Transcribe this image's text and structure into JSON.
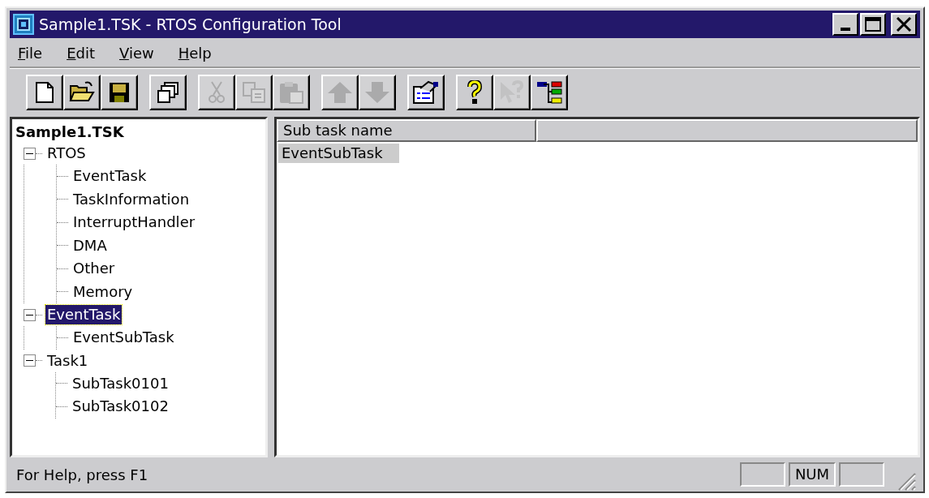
{
  "window": {
    "title": "Sample1.TSK - RTOS Configuration Tool"
  },
  "menu": [
    {
      "label": "File"
    },
    {
      "label": "Edit"
    },
    {
      "label": "View"
    },
    {
      "label": "Help"
    }
  ],
  "toolbar": [
    {
      "buttons": [
        {
          "kind": "new",
          "disabled": false
        },
        {
          "kind": "open",
          "disabled": false
        },
        {
          "kind": "save",
          "disabled": false
        }
      ]
    },
    {
      "buttons": [
        {
          "kind": "windows",
          "disabled": false
        }
      ]
    },
    {
      "buttons": [
        {
          "kind": "cut",
          "disabled": true
        },
        {
          "kind": "copy",
          "disabled": true
        },
        {
          "kind": "paste",
          "disabled": true
        }
      ]
    },
    {
      "buttons": [
        {
          "kind": "up",
          "disabled": true
        },
        {
          "kind": "down",
          "disabled": true
        }
      ]
    },
    {
      "buttons": [
        {
          "kind": "properties",
          "disabled": false
        }
      ]
    },
    {
      "buttons": [
        {
          "kind": "help",
          "disabled": false
        },
        {
          "kind": "context-help",
          "disabled": true
        },
        {
          "kind": "tree",
          "disabled": false
        }
      ]
    }
  ],
  "tree": {
    "root": "Sample1.TSK",
    "items": [
      {
        "label": "RTOS",
        "expanded": true,
        "selected": false,
        "children": [
          {
            "label": "EventTask",
            "selected": false
          },
          {
            "label": "TaskInformation",
            "selected": false
          },
          {
            "label": "InterruptHandler",
            "selected": false
          },
          {
            "label": "DMA",
            "selected": false
          },
          {
            "label": "Other",
            "selected": false
          },
          {
            "label": "Memory",
            "selected": false
          }
        ]
      },
      {
        "label": "EventTask",
        "expanded": true,
        "selected": true,
        "children": [
          {
            "label": "EventSubTask",
            "selected": false
          }
        ]
      },
      {
        "label": "Task1",
        "expanded": true,
        "selected": false,
        "children": [
          {
            "label": "SubTask0101",
            "selected": false
          },
          {
            "label": "SubTask0102",
            "selected": false
          }
        ]
      }
    ]
  },
  "list": {
    "columns": [
      "Sub task name"
    ],
    "rows": [
      {
        "name": "EventSubTask",
        "selected": true
      }
    ]
  },
  "status_bar": {
    "text": "For Help, press F1",
    "indicators": [
      {
        "kind": "blank"
      },
      {
        "kind": "text",
        "label": "NUM"
      },
      {
        "kind": "blank"
      }
    ]
  }
}
